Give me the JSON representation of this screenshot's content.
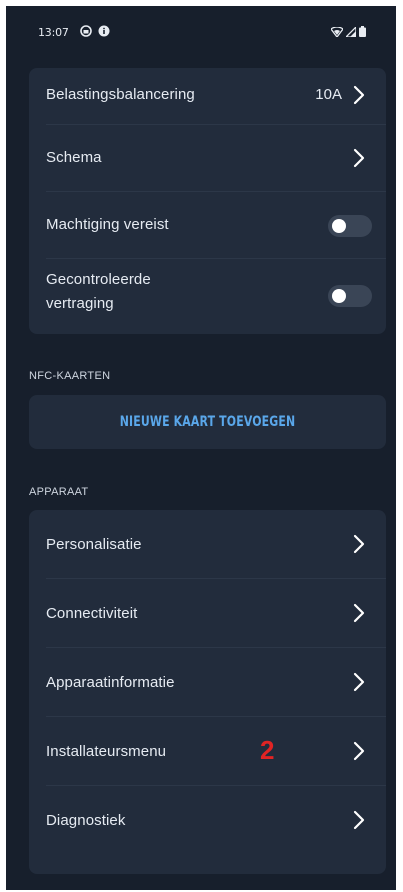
{
  "status_bar": {
    "time": "13:07"
  },
  "settings_top": {
    "rows": [
      {
        "label": "Belastingsbalancering",
        "value": "10A"
      },
      {
        "label": "Schema"
      },
      {
        "label": "Machtiging vereist",
        "toggle_on": false
      },
      {
        "label_line1": "Gecontroleerde",
        "label_line2": "vertraging",
        "toggle_on": false
      }
    ]
  },
  "nfc": {
    "header": "NFC-KAARTEN",
    "add_button": "NIEUWE KAART TOEVOEGEN"
  },
  "device": {
    "header": "APPARAAT",
    "items": [
      {
        "label": "Personalisatie"
      },
      {
        "label": "Connectiviteit"
      },
      {
        "label": "Apparaatinformatie"
      },
      {
        "label": "Installateursmenu"
      },
      {
        "label": "Diagnostiek"
      }
    ]
  },
  "annotation": {
    "text": "2",
    "color": "#e02424"
  },
  "colors": {
    "background": "#171f2c",
    "card": "#222c3c",
    "accent": "#5aa7ea"
  }
}
